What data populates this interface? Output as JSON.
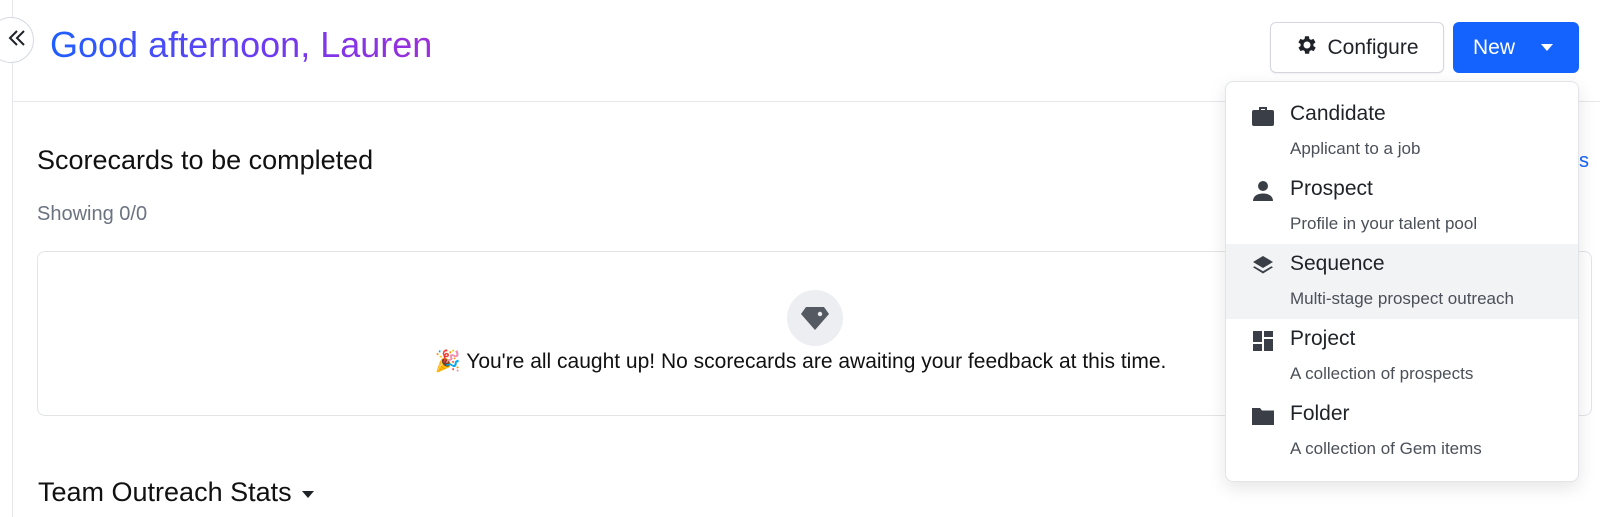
{
  "header": {
    "greeting": "Good afternoon, Lauren",
    "configure_label": "Configure",
    "new_label": "New"
  },
  "icons": {
    "collapse": "double-chevron-left-icon",
    "configure": "gear-icon",
    "empty_state": "gem-icon"
  },
  "scorecards": {
    "title": "Scorecards to be completed",
    "showing": "Showing 0/0",
    "empty_message": "🎉 You're all caught up! No scorecards are awaiting your feedback at this time.",
    "link_fragment": "s"
  },
  "team_stats": {
    "title": "Team Outreach Stats"
  },
  "new_menu": {
    "items": [
      {
        "label": "Candidate",
        "description": "Applicant to a job",
        "icon": "briefcase-icon"
      },
      {
        "label": "Prospect",
        "description": "Profile in your talent pool",
        "icon": "person-icon"
      },
      {
        "label": "Sequence",
        "description": "Multi-stage prospect outreach",
        "icon": "layers-icon",
        "highlighted": true
      },
      {
        "label": "Project",
        "description": "A collection of prospects",
        "icon": "dashboard-icon"
      },
      {
        "label": "Folder",
        "description": "A collection of Gem items",
        "icon": "folder-icon"
      }
    ]
  },
  "colors": {
    "primary": "#1463ff",
    "greeting_start": "#1f5fff",
    "greeting_end": "#9b2fd9",
    "menu_highlight": "#f2f3f5"
  }
}
